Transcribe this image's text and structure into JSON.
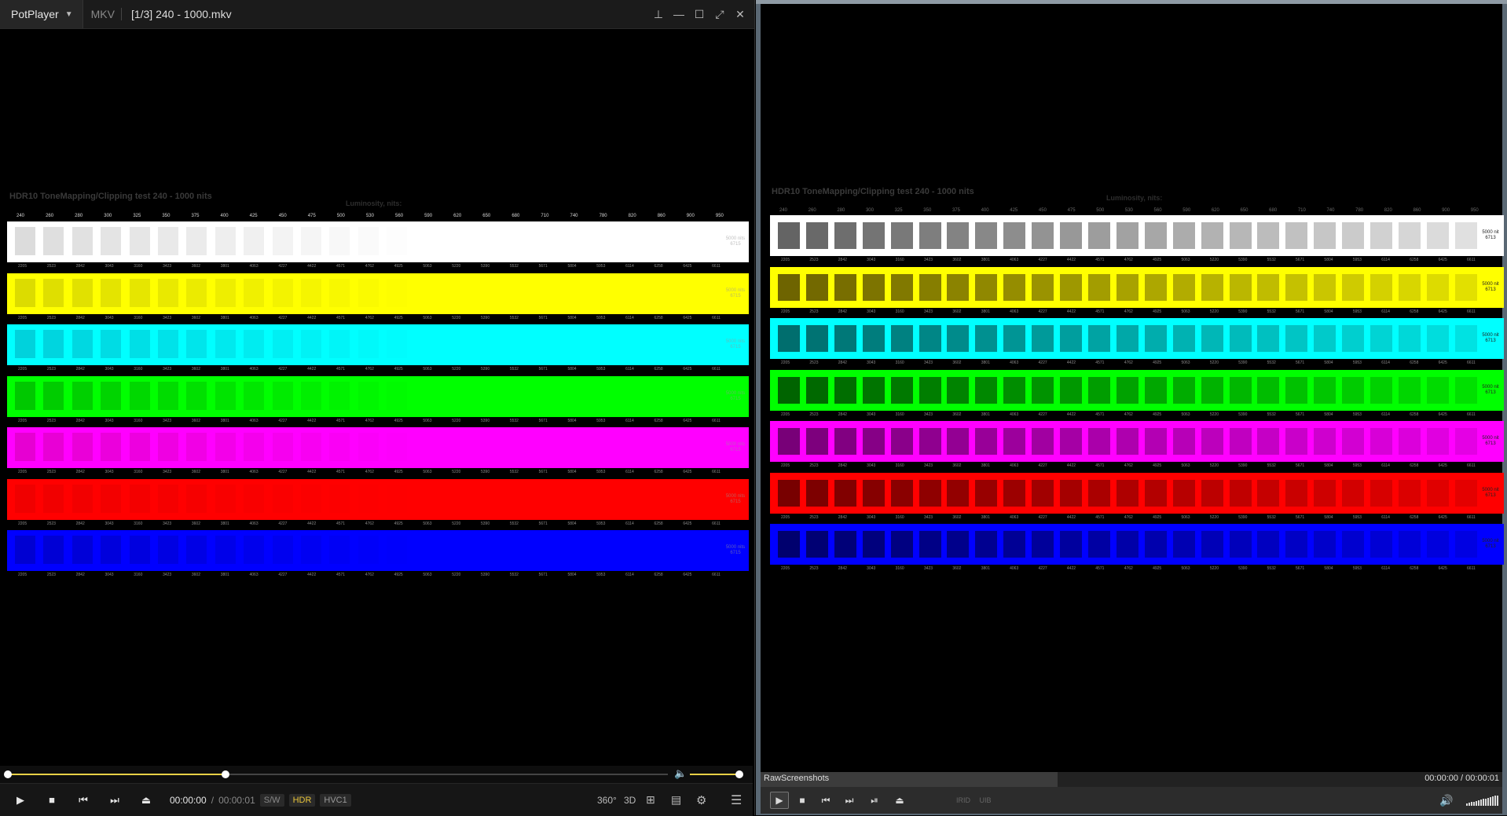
{
  "left_window": {
    "app_name": "PotPlayer",
    "format": "MKV",
    "file_title": "[1/3] 240 - 1000.mkv",
    "window_icons": [
      "pin-icon",
      "minimize-icon",
      "maximize-icon",
      "fullscreen-icon",
      "close-icon"
    ],
    "seek_fraction": 0.33,
    "volume_fraction": 1.0,
    "time_current": "00:00:00",
    "time_separator": "/",
    "time_total": "00:00:01",
    "badge_sw": "S/W",
    "badge_hdr": "HDR",
    "badge_codec": "HVC1",
    "badge_360": "360°",
    "badge_3d": "3D"
  },
  "right_window": {
    "status_label": "RawScreenshots",
    "time_display": "00:00:00 / 00:00:01",
    "seek_fraction": 0.4,
    "tag_a": "IRID",
    "tag_b": "UIB"
  },
  "test_pattern": {
    "title": "HDR10 ToneMapping/Clipping test 240 - 1000 nits",
    "subtitle": "Luminosity, nits:",
    "nit_values": [
      "240",
      "260",
      "280",
      "300",
      "325",
      "350",
      "375",
      "400",
      "425",
      "450",
      "475",
      "500",
      "530",
      "560",
      "590",
      "620",
      "650",
      "680",
      "710",
      "740",
      "780",
      "820",
      "860",
      "900",
      "950"
    ],
    "band_codes": [
      "2205",
      "2523",
      "2842",
      "3043",
      "3160",
      "3423",
      "3602",
      "3801",
      "4063",
      "4227",
      "4422",
      "4571",
      "4762",
      "4925",
      "5063",
      "5220",
      "5390",
      "5532",
      "5671",
      "5804",
      "5953",
      "6114",
      "6258",
      "6425",
      "6611"
    ],
    "colors": {
      "white": "#ffffff",
      "yellow": "#ffff00",
      "cyan": "#00ffff",
      "green": "#00ff00",
      "magenta": "#ff00ff",
      "red": "#ff0000",
      "blue": "#0000ff",
      "accent_yellow": "#e8d046"
    },
    "band_labels_left": [
      "5000 nits 6715",
      "5000 nits 6715",
      "5000 nits 6715",
      "5000 nits 6715",
      "5000 nits 6715",
      "5000 nits 6715",
      "5000 nits 6715"
    ],
    "band_labels_right": [
      "5000 nit 6713",
      "5000 nit 6713",
      "5000 nit 6713",
      "5000 nit 6713",
      "5000 nit 6713",
      "5000 nit 6713",
      "5000 nit 6713"
    ]
  }
}
